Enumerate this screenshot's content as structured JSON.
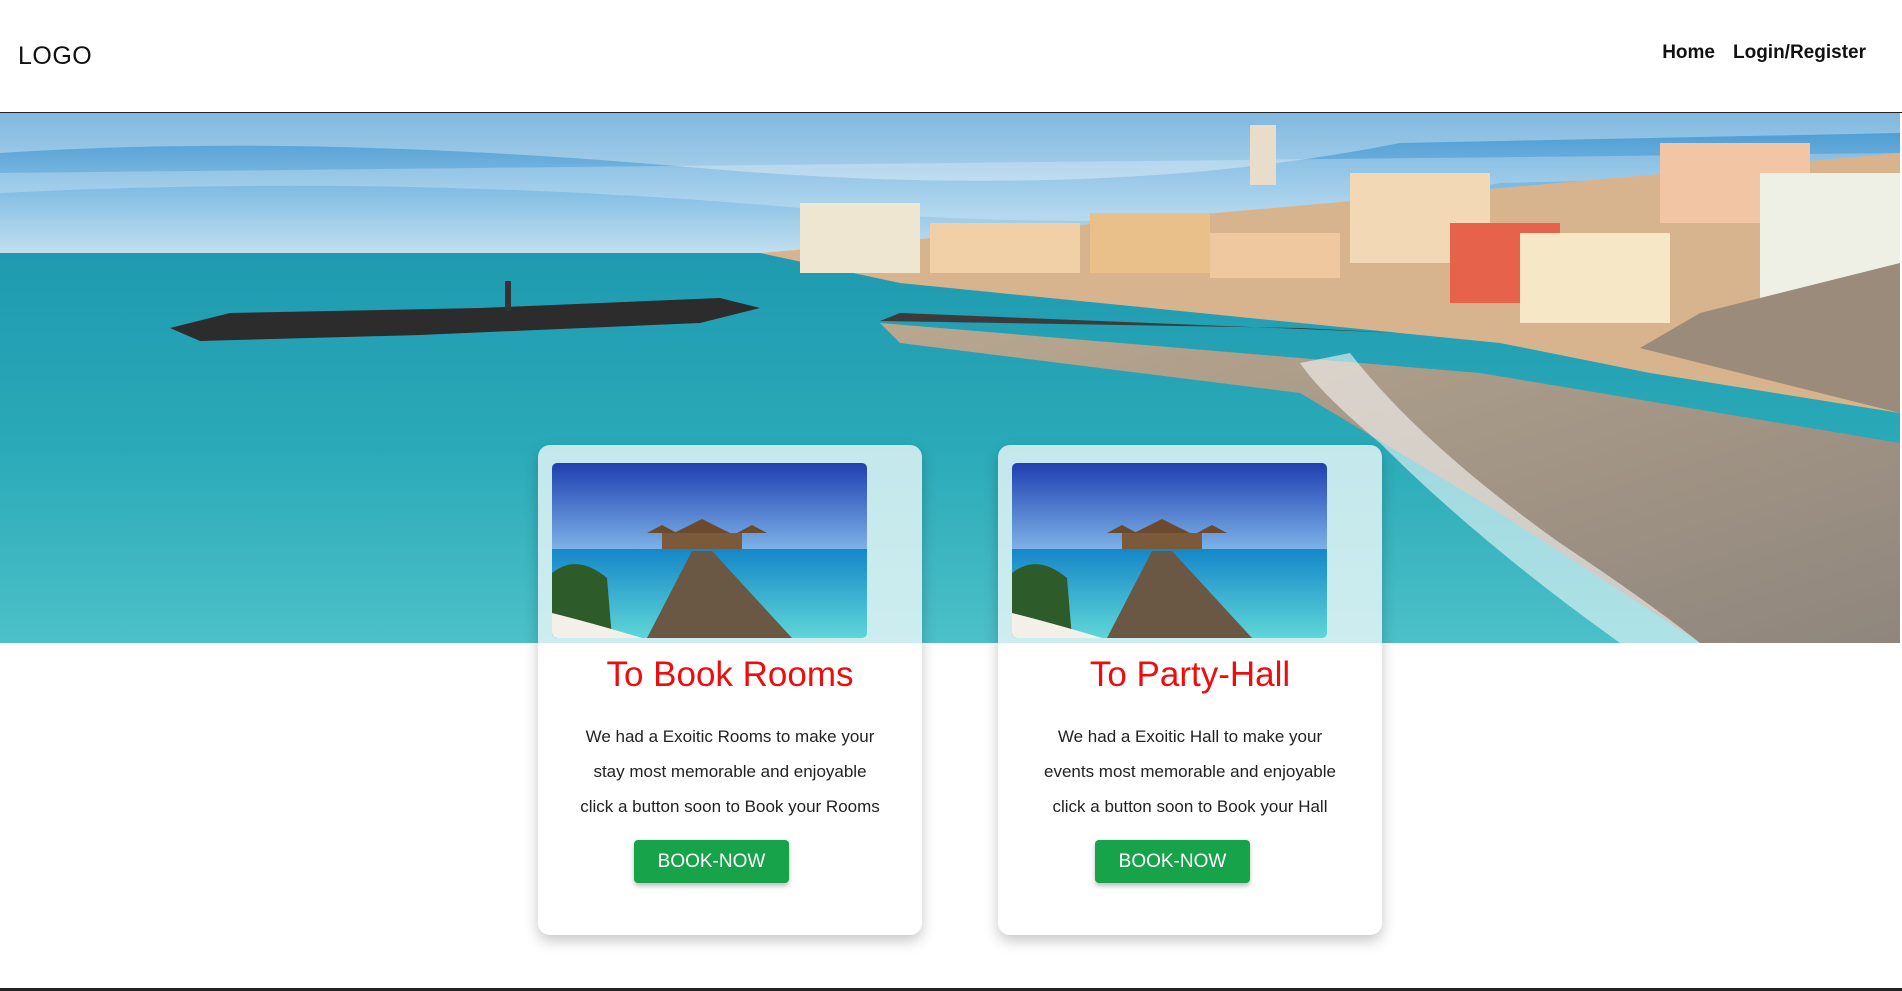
{
  "header": {
    "logo": "LOGO",
    "nav": {
      "home": "Home",
      "login_register": "Login/Register"
    }
  },
  "hero": {
    "image": "coastal-village-beach-photo"
  },
  "cards": [
    {
      "image": "overwater-bungalow-pier-photo",
      "title": "To Book Rooms",
      "text_lines": [
        "We had a Exoitic Rooms to make your",
        "stay most memorable and enjoyable",
        "click a button soon to Book your Rooms"
      ],
      "button": "BOOK-NOW"
    },
    {
      "image": "overwater-bungalow-pier-photo",
      "title": "To Party-Hall",
      "text_lines": [
        "We had a Exoitic Hall to make your",
        "events most memorable and enjoyable",
        "click a button soon to Book your Hall"
      ],
      "button": "BOOK-NOW"
    }
  ],
  "colors": {
    "title_red": "#ee0c0c",
    "button_green": "#17a34a",
    "sea": "#29a9b4",
    "sky": "#5ea6d6"
  }
}
